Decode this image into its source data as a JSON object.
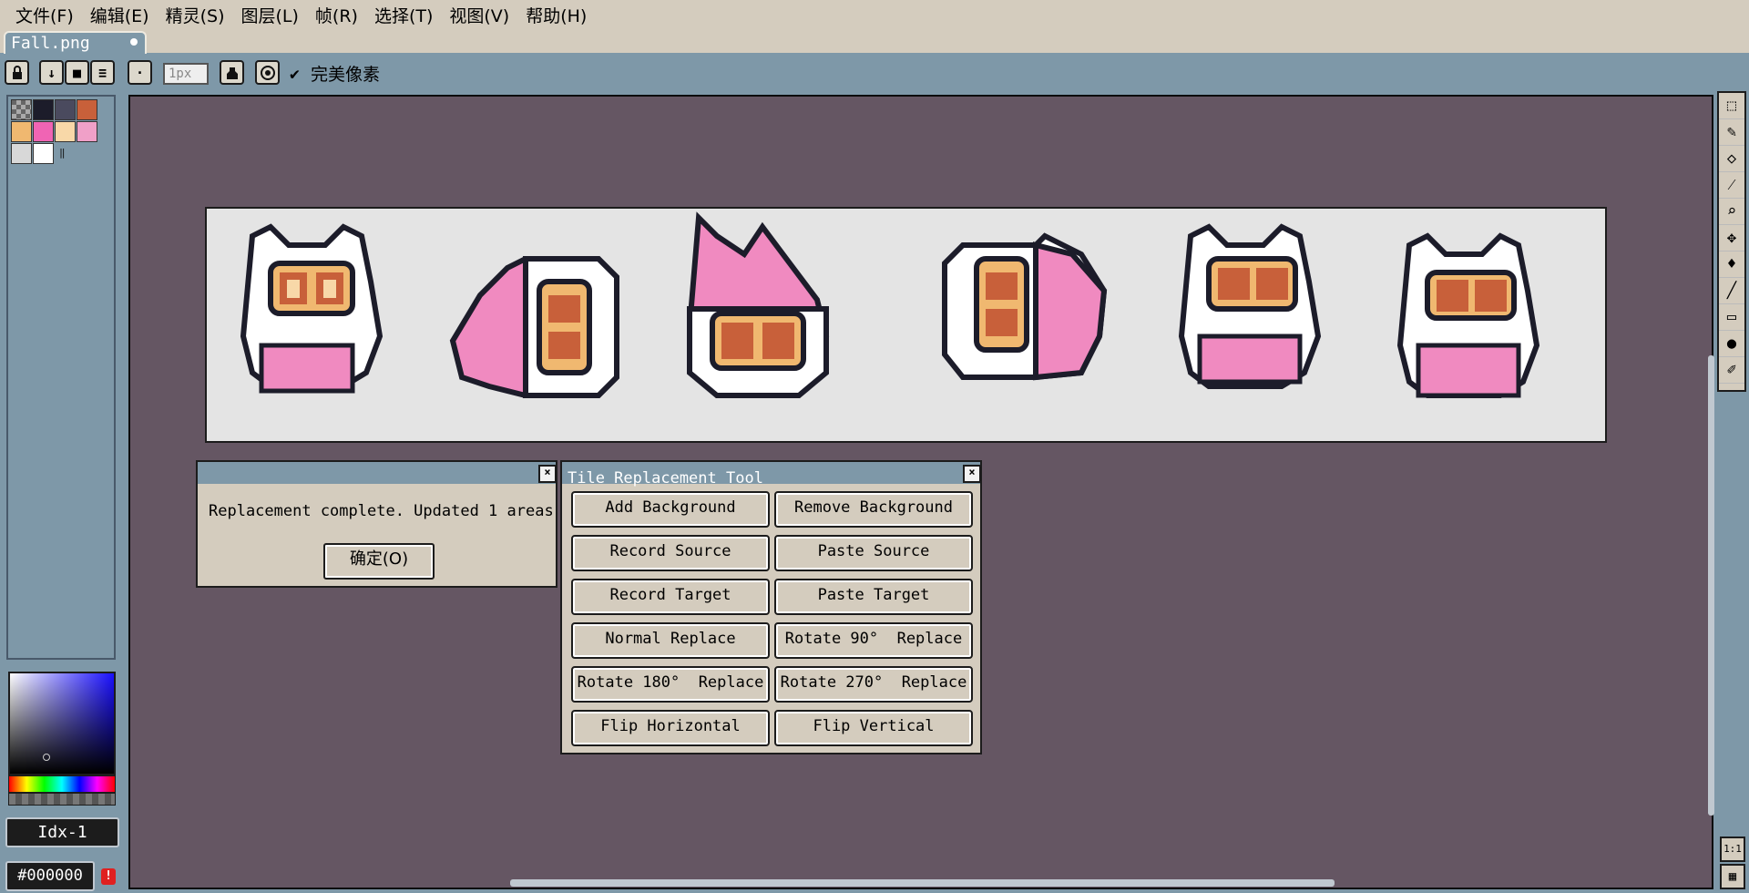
{
  "menu": [
    "文件(F)",
    "编辑(E)",
    "精灵(S)",
    "图层(L)",
    "帧(R)",
    "选择(T)",
    "视图(V)",
    "帮助(H)"
  ],
  "tab": {
    "filename": "Fall.png"
  },
  "toolbar": {
    "lock_icon": "lock-icon",
    "brush_size": "1px",
    "perfect_pixel_label": "完美像素",
    "perfect_pixel_checked": true
  },
  "palette": {
    "colors": [
      "#c8c8c8",
      "#1c1c2a",
      "#4a4a5e",
      "#c8603a",
      "#f0b870",
      "#f064b4",
      "#f8d8a8",
      "#f0a0c8",
      "#d8d8d8",
      "#ffffff"
    ]
  },
  "color_panel": {
    "index_label": "Idx-1",
    "hex_value": "#000000",
    "warning_icon": "!"
  },
  "dialog": {
    "message": "Replacement complete. Updated 1 areas",
    "ok_label": "确定(O)"
  },
  "tile_tool": {
    "title": "Tile Replacement Tool",
    "buttons": [
      [
        "Add Background",
        "Remove Background"
      ],
      [
        "Record Source",
        "Paste Source"
      ],
      [
        "Record Target",
        "Paste Target"
      ],
      [
        "Normal Replace",
        "Rotate 90°  Replace"
      ],
      [
        "Rotate 180°  Replace",
        "Rotate 270°  Replace"
      ],
      [
        "Flip Horizontal",
        "Flip Vertical"
      ]
    ]
  },
  "right_tools": [
    "marquee-icon",
    "pencil-icon",
    "eraser-icon",
    "eyedropper-icon",
    "zoom-icon",
    "move-icon",
    "fill-icon",
    "line-icon",
    "rectangle-icon",
    "ellipse-icon",
    "contour-icon"
  ],
  "zoom_label": "1:1"
}
